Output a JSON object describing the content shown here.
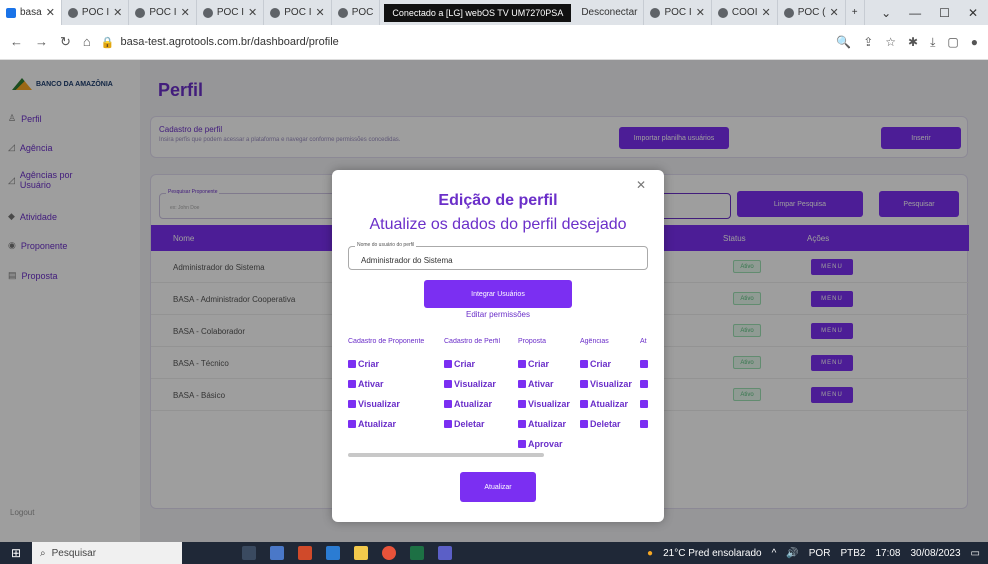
{
  "browser": {
    "tabs": [
      {
        "label": "basa",
        "active": true
      },
      {
        "label": "POC I"
      },
      {
        "label": "POC I"
      },
      {
        "label": "POC I"
      },
      {
        "label": "POC I"
      },
      {
        "label": "POC"
      }
    ],
    "remote_label": "Conectado a [LG] webOS TV UM7270PSA",
    "disconnect_label": "Desconectar",
    "tabs_right": [
      {
        "label": "POC I"
      },
      {
        "label": "COOI"
      },
      {
        "label": "POC ("
      }
    ],
    "new_tab": "+",
    "url": "basa-test.agrotools.com.br/dashboard/profile"
  },
  "brand": "BANCO DA AMAZÔNIA",
  "sidebar": {
    "items": [
      {
        "label": "Perfil",
        "icon": "user-icon"
      },
      {
        "label": "Agência",
        "icon": "building-icon"
      },
      {
        "label": "Agências por Usuário",
        "icon": "building-icon"
      },
      {
        "label": "Atividade",
        "icon": "leaf-icon"
      },
      {
        "label": "Proponente",
        "icon": "target-icon"
      },
      {
        "label": "Proposta",
        "icon": "document-icon"
      }
    ],
    "logout": "Logout"
  },
  "page": {
    "title": "Perfil",
    "cadastro_title": "Cadastro de perfil",
    "cadastro_sub": "Insira perfis que podem acessar a plataforma e navegar conforme permissões concedidas.",
    "import_btn": "Importar planilha usuários",
    "insert_btn": "Inserir",
    "search_label": "Pesquisar Proponente",
    "search_placeholder": "ex: John Doe",
    "clear_btn": "Limpar Pesquisa",
    "search_btn": "Pesquisar",
    "columns": [
      "Nome",
      "Status",
      "Ações"
    ],
    "rows": [
      {
        "name": "Administrador do Sistema",
        "status": "Ativo",
        "action": "MENU"
      },
      {
        "name": "BASA - Administrador Cooperativa",
        "status": "Ativo",
        "action": "MENU"
      },
      {
        "name": "BASA - Colaborador",
        "status": "Ativo",
        "action": "MENU"
      },
      {
        "name": "BASA - Técnico",
        "status": "Ativo",
        "action": "MENU"
      },
      {
        "name": "BASA - Básico",
        "status": "Ativo",
        "action": "MENU"
      }
    ]
  },
  "modal": {
    "title": "Edição de perfil",
    "subtitle": "Atualize os dados do perfil desejado",
    "field_label": "Nome do usuário do perfil",
    "field_value": "Administrador do Sistema",
    "integrate_btn": "Integrar Usuários",
    "edit_link": "Editar permissões",
    "columns": [
      {
        "header": "Cadastro de Proponente",
        "items": [
          "Criar",
          "Ativar",
          "Visualizar",
          "Atualizar"
        ]
      },
      {
        "header": "Cadastro de Perfil",
        "items": [
          "Criar",
          "Visualizar",
          "Atualizar",
          "Deletar"
        ]
      },
      {
        "header": "Proposta",
        "items": [
          "Criar",
          "Ativar",
          "Visualizar",
          "Atualizar",
          "Aprovar"
        ]
      },
      {
        "header": "Agências",
        "items": [
          "Criar",
          "Visualizar",
          "Atualizar",
          "Deletar"
        ]
      },
      {
        "header": "At",
        "items": [
          "",
          "",
          "",
          ""
        ]
      }
    ],
    "update_btn": "Atualizar"
  },
  "taskbar": {
    "search": "Pesquisar",
    "weather": "21°C Pred ensolarado",
    "lang": "POR",
    "lang2": "PTB2",
    "time": "17:08",
    "date": "30/08/2023"
  }
}
